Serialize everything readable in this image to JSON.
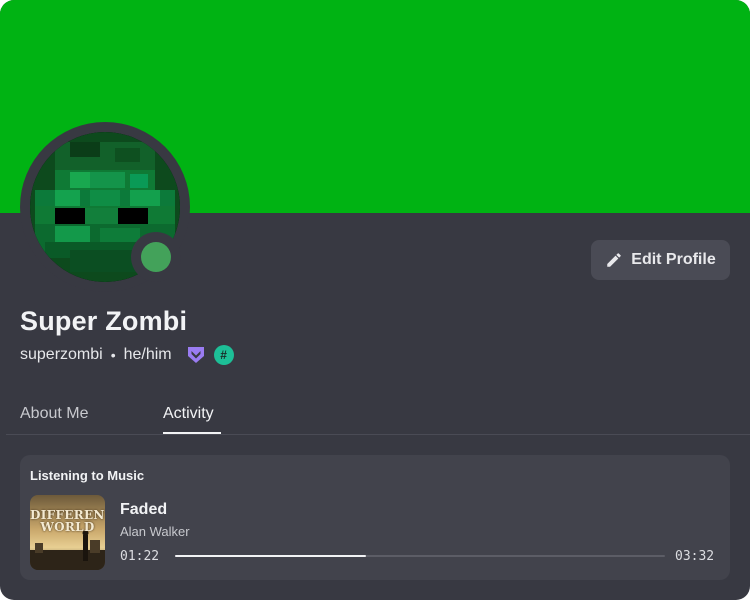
{
  "theme": {
    "banner_color": "#00b313",
    "card_color": "#383942",
    "status_color": "#43a25a"
  },
  "profile": {
    "display_name": "Super Zombi",
    "username": "superzombi",
    "separator": "•",
    "pronouns": "he/him",
    "status": "online",
    "badges": [
      {
        "icon": "hypesquad-balance-icon",
        "color": "#9a7cf2"
      },
      {
        "icon": "hashtag-icon",
        "label": "#",
        "color": "#1dbf97"
      }
    ]
  },
  "actions": {
    "edit_profile_label": "Edit Profile",
    "edit_profile_icon": "pencil-icon"
  },
  "tabs": [
    {
      "label": "About Me",
      "active": false
    },
    {
      "label": "Activity",
      "active": true
    }
  ],
  "activity": {
    "heading": "Listening to Music",
    "album_art_text": [
      "DIFFERENT",
      "WORLD"
    ],
    "track_title": "Faded",
    "artist": "Alan Walker",
    "elapsed": "01:22",
    "duration": "03:32",
    "progress_fraction": 0.39
  }
}
